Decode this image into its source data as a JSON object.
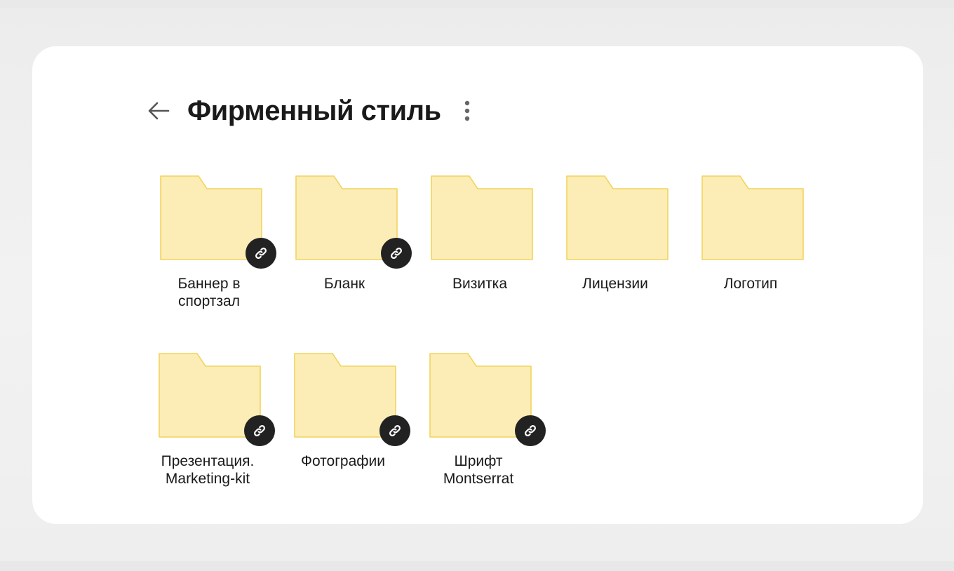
{
  "page": {
    "title": "Фирменный стиль",
    "back_icon": "arrow-left-icon",
    "more_icon": "kebab-menu-icon"
  },
  "colors": {
    "folder_fill": "#FBEDB5",
    "folder_stroke": "#F2D45E",
    "badge": "#222222",
    "card": "#FFFFFF",
    "background": "#EFEFEF"
  },
  "folders": [
    {
      "name": "Баннер в\nспортзал",
      "shared": true
    },
    {
      "name": "Бланк",
      "shared": true
    },
    {
      "name": "Визитка",
      "shared": false
    },
    {
      "name": "Лицензии",
      "shared": false
    },
    {
      "name": "Логотип",
      "shared": false
    },
    {
      "name": "Презентация.\nMarketing-kit",
      "shared": true
    },
    {
      "name": "Фотографии",
      "shared": true
    },
    {
      "name": "Шрифт\nMontserrat",
      "shared": true
    }
  ]
}
